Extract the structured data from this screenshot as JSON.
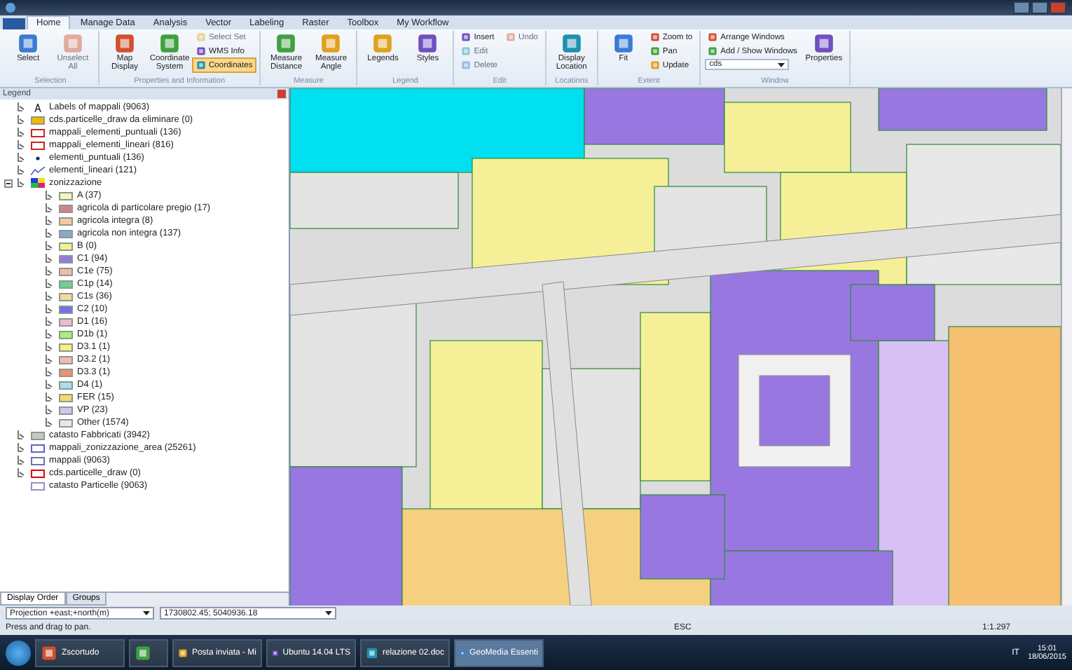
{
  "ribbon": {
    "tabs": [
      {
        "label": "Home",
        "selected": true
      },
      {
        "label": "Manage Data",
        "selected": false
      },
      {
        "label": "Analysis",
        "selected": false
      },
      {
        "label": "Vector",
        "selected": false
      },
      {
        "label": "Labeling",
        "selected": false
      },
      {
        "label": "Raster",
        "selected": false
      },
      {
        "label": "Toolbox",
        "selected": false
      },
      {
        "label": "My Workflow",
        "selected": false
      }
    ],
    "groups": [
      {
        "title": "Selection",
        "items": [
          {
            "label": "Select",
            "kind": "large",
            "disabled": false,
            "selected": false
          },
          {
            "label": "Unselect All",
            "kind": "large",
            "disabled": true,
            "selected": false
          }
        ]
      },
      {
        "title": "Properties and Information",
        "items": [
          {
            "label": "Map Display",
            "kind": "large",
            "disabled": false,
            "selected": false
          },
          {
            "label": "Coordinate System",
            "kind": "large",
            "disabled": false,
            "selected": false
          },
          {
            "label": "Select Set",
            "kind": "small",
            "disabled": true,
            "selected": false
          },
          {
            "label": "WMS Info",
            "kind": "small",
            "disabled": false,
            "selected": false
          },
          {
            "label": "Coordinates",
            "kind": "small",
            "disabled": false,
            "selected": true
          }
        ]
      },
      {
        "title": "Measure",
        "items": [
          {
            "label": "Measure Distance",
            "kind": "large",
            "disabled": false,
            "selected": false
          },
          {
            "label": "Measure Angle",
            "kind": "large",
            "disabled": false,
            "selected": false
          }
        ]
      },
      {
        "title": "Legend",
        "items": [
          {
            "label": "Legends",
            "kind": "large",
            "disabled": false,
            "selected": false
          },
          {
            "label": "Styles",
            "kind": "large",
            "disabled": false,
            "selected": false
          }
        ]
      },
      {
        "title": "Edit",
        "items": [
          {
            "label": "Insert",
            "kind": "small",
            "disabled": false,
            "selected": false
          },
          {
            "label": "Edit",
            "kind": "small",
            "disabled": true,
            "selected": false
          },
          {
            "label": "Delete",
            "kind": "small",
            "disabled": true,
            "selected": false
          },
          {
            "label": "Undo",
            "kind": "small",
            "disabled": true,
            "selected": false
          }
        ]
      },
      {
        "title": "Locations",
        "items": [
          {
            "label": "Display Location",
            "kind": "large",
            "disabled": false,
            "selected": false
          }
        ]
      },
      {
        "title": "Extent",
        "items": [
          {
            "label": "Fit",
            "kind": "large",
            "disabled": false,
            "selected": false
          },
          {
            "label": "Zoom to",
            "kind": "small",
            "disabled": false,
            "selected": false
          },
          {
            "label": "Pan",
            "kind": "small",
            "disabled": false,
            "selected": false
          },
          {
            "label": "Update",
            "kind": "small",
            "disabled": false,
            "selected": false
          }
        ]
      },
      {
        "title": "Window",
        "items": [
          {
            "label": "Arrange Windows",
            "kind": "small",
            "disabled": false,
            "selected": false
          },
          {
            "label": "Add / Show Windows",
            "kind": "small",
            "disabled": false,
            "selected": false
          },
          {
            "label": "cds",
            "kind": "combo"
          },
          {
            "label": "Properties",
            "kind": "large",
            "disabled": false,
            "selected": false
          }
        ]
      }
    ]
  },
  "legend": {
    "title": "Legend",
    "items": [
      {
        "label": "Labels of mappali (9063)",
        "kind": "text",
        "visible": true
      },
      {
        "label": "cds.particelle_draw da eliminare (0)",
        "kind": "fill",
        "color": "#f5b800",
        "visible": true
      },
      {
        "label": "mappali_elementi_puntuali (136)",
        "kind": "framed",
        "color": "#d02020",
        "visible": true
      },
      {
        "label": "mappali_elementi_lineari (816)",
        "kind": "framed",
        "color": "#d02020",
        "visible": true
      },
      {
        "label": "elementi_puntuali (136)",
        "kind": "point",
        "visible": true
      },
      {
        "label": "elementi_lineari (121)",
        "kind": "line",
        "visible": true
      },
      {
        "label": "zonizzazione",
        "kind": "thematic",
        "visible": true,
        "expanded": true,
        "children": [
          {
            "label": "A (37)",
            "kind": "fill",
            "color": "#f5f5c0",
            "visible": true
          },
          {
            "label": "agricola di particolare pregio (17)",
            "kind": "fill",
            "color": "#d98090",
            "visible": true
          },
          {
            "label": "agricola integra (8)",
            "kind": "fill",
            "color": "#f5c8a8",
            "visible": true
          },
          {
            "label": "agricola non integra (137)",
            "kind": "fill",
            "color": "#88a8d0",
            "visible": true
          },
          {
            "label": "B (0)",
            "kind": "fill",
            "color": "#f5f098",
            "visible": true
          },
          {
            "label": "C1 (94)",
            "kind": "fill",
            "color": "#9878e0",
            "visible": true
          },
          {
            "label": "C1e (75)",
            "kind": "fill",
            "color": "#f5b8b0",
            "visible": true
          },
          {
            "label": "C1p (14)",
            "kind": "fill",
            "color": "#70d090",
            "visible": true
          },
          {
            "label": "C1s (36)",
            "kind": "fill",
            "color": "#f5d8a0",
            "visible": true
          },
          {
            "label": "C2 (10)",
            "kind": "fill",
            "color": "#7070f0",
            "visible": true
          },
          {
            "label": "D1 (16)",
            "kind": "fill",
            "color": "#f5b8d0",
            "visible": true
          },
          {
            "label": "D1b (1)",
            "kind": "fill",
            "color": "#a8f080",
            "visible": true
          },
          {
            "label": "D3.1 (1)",
            "kind": "fill",
            "color": "#f5f080",
            "visible": true
          },
          {
            "label": "D3.2 (1)",
            "kind": "fill",
            "color": "#f5b8b8",
            "visible": true
          },
          {
            "label": "D3.3 (1)",
            "kind": "fill",
            "color": "#f09070",
            "visible": true
          },
          {
            "label": "D4 (1)",
            "kind": "fill",
            "color": "#a8e0f0",
            "visible": true
          },
          {
            "label": "FER (15)",
            "kind": "fill",
            "color": "#f5d870",
            "visible": true
          },
          {
            "label": "VP (23)",
            "kind": "fill",
            "color": "#d8c0f5",
            "visible": true
          },
          {
            "label": "Other (1574)",
            "kind": "fill",
            "color": "#e8e8e8",
            "visible": true
          }
        ]
      },
      {
        "label": "catasto Fabbricati (3942)",
        "kind": "fill",
        "color": "#c8c8c8",
        "visible": true
      },
      {
        "label": "mappali_zonizzazione_area (25261)",
        "kind": "framed",
        "color": "#6060d0",
        "visible": true
      },
      {
        "label": "mappali (9063)",
        "kind": "outline",
        "color": "#7070b0",
        "visible": true
      },
      {
        "label": "cds.particelle_draw (0)",
        "kind": "framed",
        "color": "#e00000",
        "visible": true
      },
      {
        "label": "catasto Particelle (9063)",
        "kind": "outline",
        "color": "#9090c8",
        "visible": false
      }
    ],
    "tabs": [
      {
        "label": "Display Order",
        "selected": true
      },
      {
        "label": "Groups",
        "selected": false
      }
    ]
  },
  "coordinates": {
    "system": "Projection +east;+north(m)",
    "value": "1730802.45; 5040936.18"
  },
  "status_bar": {
    "message": "Press and drag to pan.",
    "key": "ESC",
    "scale": "1:1.297"
  },
  "taskbar": {
    "items": [
      {
        "label": "Zscortudo",
        "selected": false
      },
      {
        "selected": false
      },
      {
        "label": "Posta inviata - Mi",
        "selected": false
      },
      {
        "label": "Ubuntu 14.04 LTS",
        "selected": false
      },
      {
        "label": "relazione 02.doc",
        "selected": false
      },
      {
        "label": "GeoMedia Essenti",
        "selected": true
      }
    ],
    "language": "IT",
    "time": "15:01",
    "date": "18/06/2015"
  }
}
